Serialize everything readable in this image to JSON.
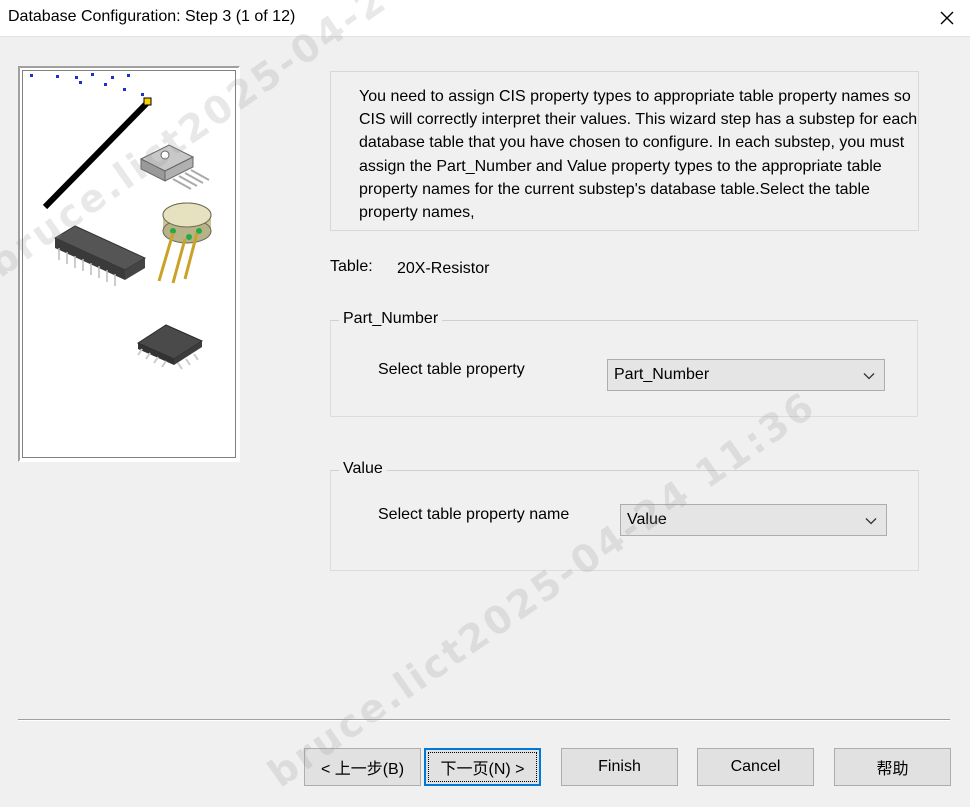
{
  "window": {
    "title": "Database Configuration: Step 3 (1 of 12)"
  },
  "description": "You need to assign CIS property types to appropriate table property names so CIS will correctly interpret their values. This wizard step has a substep for each database table that you have chosen to configure. In each substep, you must assign the Part_Number and Value property types to the appropriate table property names for the current substep's database table.Select the table property names,",
  "table": {
    "label": "Table:",
    "value": "20X-Resistor"
  },
  "part_number_group": {
    "legend": "Part_Number",
    "field_label": "Select table property",
    "selected": "Part_Number"
  },
  "value_group": {
    "legend": "Value",
    "field_label": "Select table property name",
    "selected": "Value"
  },
  "buttons": {
    "back": "< 上一步(B)",
    "next": "下一页(N) >",
    "finish": "Finish",
    "cancel": "Cancel",
    "help": "帮助"
  },
  "watermark": {
    "line1": "bruce.lict2025-04-24 11:36",
    "line2": "bruce.lict2025-04-24 11:36"
  }
}
